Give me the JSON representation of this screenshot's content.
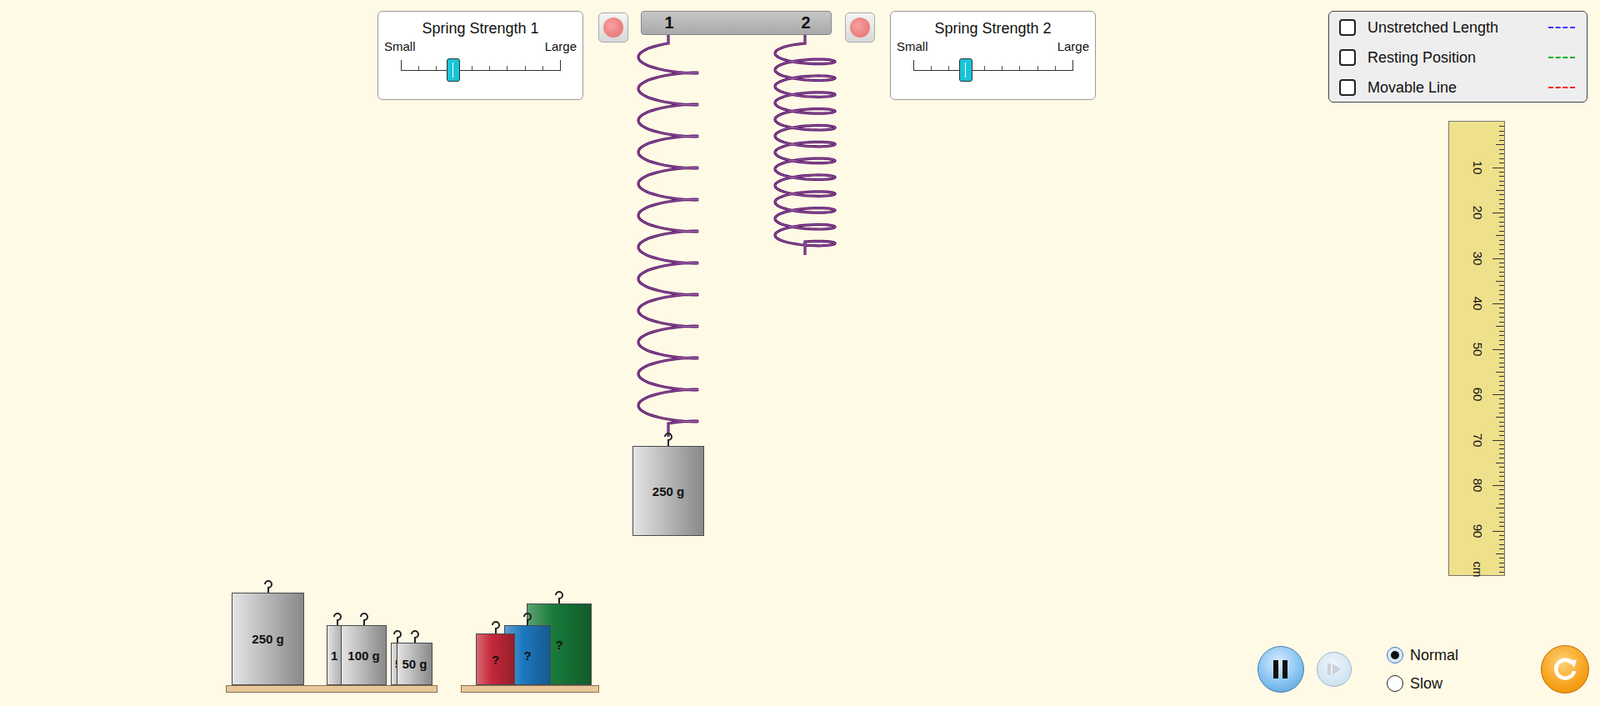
{
  "spring_controls": [
    {
      "title": "Spring Strength 1",
      "min_label": "Small",
      "max_label": "Large",
      "level": 0.33
    },
    {
      "title": "Spring Strength 2",
      "min_label": "Small",
      "max_label": "Large",
      "level": 0.33
    }
  ],
  "springs": [
    {
      "label": "1",
      "attached_mass": "250 g"
    },
    {
      "label": "2",
      "attached_mass": null
    }
  ],
  "visibility_options": [
    {
      "label": "Unstretched Length",
      "checked": false,
      "color": "#3a3aff"
    },
    {
      "label": "Resting Position",
      "checked": false,
      "color": "#1fae1f"
    },
    {
      "label": "Movable Line",
      "checked": false,
      "color": "#ff2020"
    }
  ],
  "ruler": {
    "ticks": [
      "10",
      "20",
      "30",
      "40",
      "50",
      "60",
      "70",
      "80",
      "90"
    ],
    "unit": "cm"
  },
  "labeled_masses": [
    {
      "label": "250 g"
    },
    {
      "label": "1"
    },
    {
      "label": "100 g"
    },
    {
      "label": "5"
    },
    {
      "label": "50 g"
    }
  ],
  "mystery_masses": [
    {
      "label": "?",
      "color": "#c62839"
    },
    {
      "label": "?",
      "color": "#1c78bf"
    },
    {
      "label": "?",
      "color": "#187a3a"
    }
  ],
  "playback": {
    "playing": true
  },
  "speed_options": [
    {
      "label": "Normal",
      "selected": true
    },
    {
      "label": "Slow",
      "selected": false
    }
  ]
}
